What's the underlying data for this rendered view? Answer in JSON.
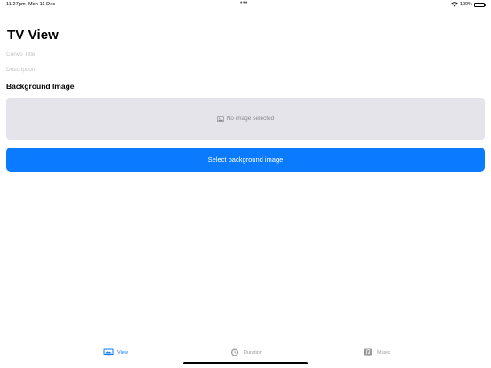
{
  "status_bar": {
    "time": "11:27pm",
    "date": "Mon 11 Dec",
    "battery": "100%",
    "more_dots": "•••"
  },
  "page": {
    "title": "TV View"
  },
  "form": {
    "convo_title_placeholder": "Convo Title",
    "description_placeholder": "Description"
  },
  "background_image": {
    "heading": "Background Image",
    "empty_label": "No image selected",
    "select_button_label": "Select background image"
  },
  "tabs": [
    {
      "label": "View",
      "icon": "tv-icon",
      "active": true
    },
    {
      "label": "Duration",
      "icon": "clock-icon",
      "active": false
    },
    {
      "label": "Music",
      "icon": "music-note-icon",
      "active": false
    }
  ],
  "colors": {
    "accent": "#0a7bff",
    "placeholder_bg": "#e4e4ea",
    "inactive_tab": "#9a9a9e"
  }
}
